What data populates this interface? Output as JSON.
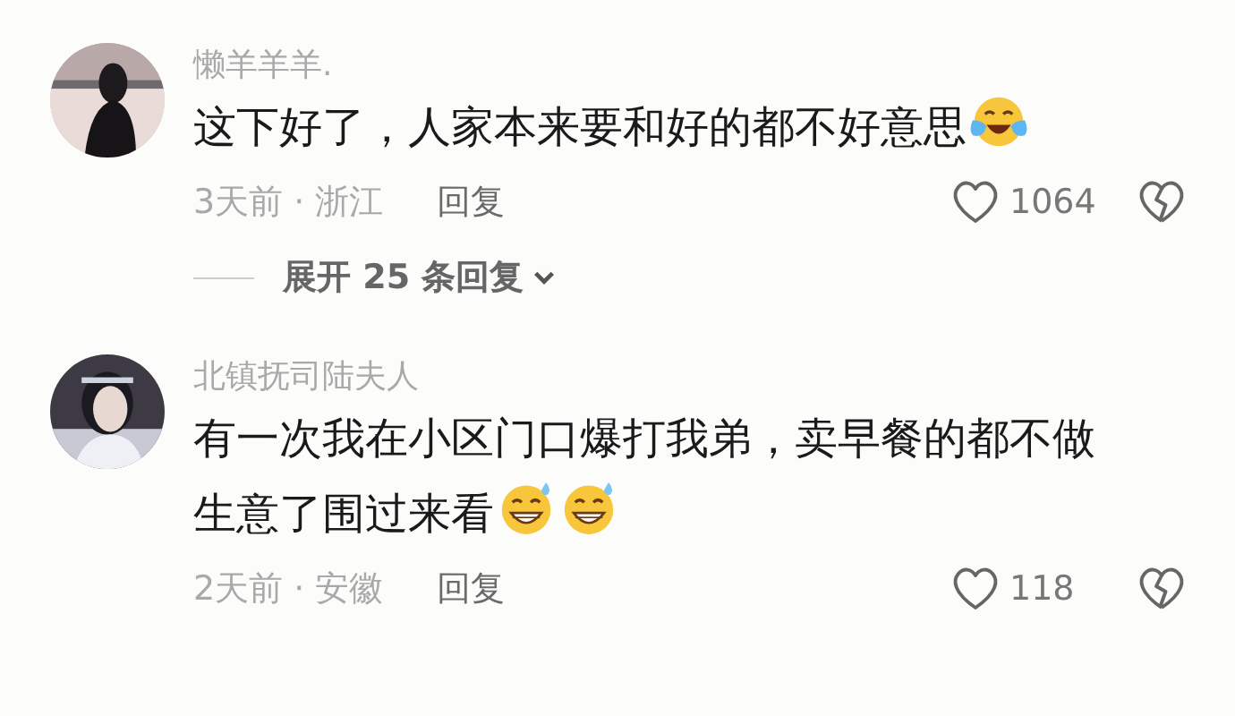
{
  "comments": [
    {
      "username": "懒羊羊羊.",
      "text_lines": [
        "这下好了，人家本来要和好的都不好意思"
      ],
      "emojis": [
        {
          "kind": "tears"
        }
      ],
      "meta": "3天前 · 浙江",
      "reply": "回复",
      "likes": "1064",
      "expand": {
        "label": "展开 25 条回复"
      }
    },
    {
      "username": "北镇抚司陆夫人",
      "text_lines": [
        "有一次我在小区门口爆打我弟，卖早餐的都不做",
        "生意了围过来看"
      ],
      "emojis": [
        {
          "kind": "sweat"
        },
        {
          "kind": "sweat"
        }
      ],
      "meta": "2天前 · 安徽",
      "reply": "回复",
      "likes": "118"
    }
  ]
}
